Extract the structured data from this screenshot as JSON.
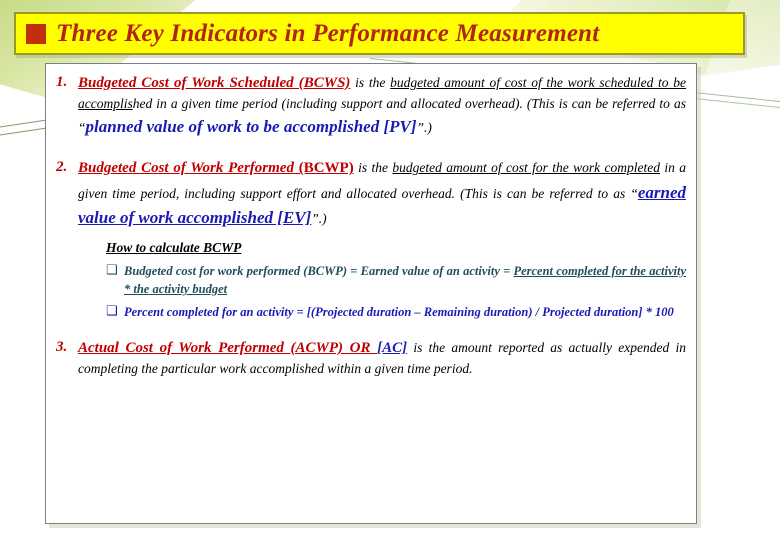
{
  "slide": {
    "title": "Three Key Indicators in Performance Measurement",
    "title_bullet_icon": "red-square-bullet",
    "accent_colors": {
      "banner_bg": "#ffff00",
      "banner_border": "#9a9a24",
      "title_text": "#b2241b",
      "bullet_square": "#c0300c",
      "heading_red": "#c00000",
      "emphasis_blue": "#1a1ab4",
      "teal": "#1f4e5c",
      "panel_border": "#7f7f7f"
    }
  },
  "items": [
    {
      "number": "1.",
      "heading": "Budgeted Cost of Work Scheduled (BCWS)",
      "text_a": " is the ",
      "underlined_a": "budgeted amount of cost of the work scheduled to be accomplis",
      "text_b": "hed in a given time period (including support and allocated overhead). (This is can be referred to as ",
      "quote_open": "“",
      "emphasis": "planned value of work to be accomplished [PV]",
      "quote_close": "”.)"
    },
    {
      "number": "2.",
      "heading_italic": "Budgeted Cost of Work Performed",
      "heading_plain": " (BCWP)",
      "text_a": " is the ",
      "underlined_a": "budgeted amount of cost for the work completed",
      "text_b": " in a given time period, including support effort and allocated overhead. (This is can be referred to as ",
      "quote_open": "“",
      "emphasis": "earned value of work accomplished [EV]",
      "quote_close": "”.)"
    },
    {
      "number": "3.",
      "heading": "Actual Cost of Work Performed (ACWP) OR ",
      "heading_blue": "[AC]",
      "text_a": " is the amount reported as actually expended in completing the particular work accomplished within a given time period."
    }
  ],
  "subsection": {
    "title": "How to calculate BCWP",
    "bullet_icon": "hollow-square-bullet",
    "bullet_glyph": "❑",
    "bullets": [
      {
        "lead": "Budgeted cost for work performed (BCWP) = Earned value of an activity = ",
        "underlined": "Percent completed for the activity * the activity budget"
      },
      {
        "lead": "Percent completed for an activity = [(Projected duration – Remaining duration) / Projected duration] * 100"
      }
    ]
  }
}
